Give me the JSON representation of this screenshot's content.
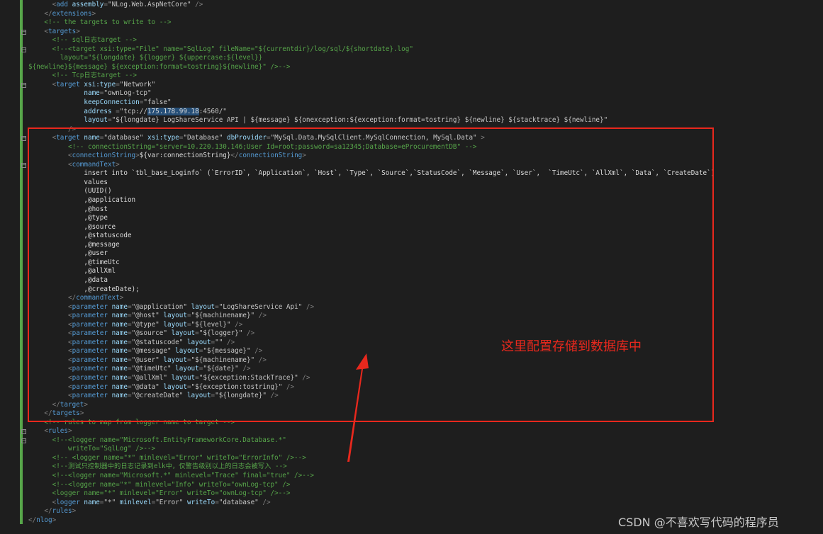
{
  "colors": {
    "background": "#1e1e1e",
    "tag": "#569cd6",
    "attribute": "#9cdcfe",
    "value": "#c8c8c8",
    "comment": "#57a64a",
    "annotation": "#e8281d"
  },
  "lines": [
    {
      "indent": 6,
      "fold": false,
      "tokens": [
        [
          "d",
          "<"
        ],
        [
          "g",
          "add"
        ],
        [
          "t",
          " "
        ],
        [
          "a",
          "assembly"
        ],
        [
          "d",
          "="
        ],
        [
          "v",
          "\"NLog.Web.AspNetCore\""
        ],
        [
          "d",
          " />"
        ]
      ]
    },
    {
      "indent": 4,
      "fold": false,
      "tokens": [
        [
          "d",
          "</"
        ],
        [
          "g",
          "extensions"
        ],
        [
          "d",
          ">"
        ]
      ]
    },
    {
      "indent": 4,
      "fold": false,
      "tokens": [
        [
          "c",
          "<!-- the targets to write to -->"
        ]
      ]
    },
    {
      "indent": 4,
      "fold": true,
      "tokens": [
        [
          "d",
          "<"
        ],
        [
          "g",
          "targets"
        ],
        [
          "d",
          ">"
        ]
      ]
    },
    {
      "indent": 6,
      "fold": false,
      "tokens": [
        [
          "c",
          "<!-- sql日志target -->"
        ]
      ]
    },
    {
      "indent": 6,
      "fold": true,
      "tokens": [
        [
          "c",
          "<!--<target xsi:type=\"File\" name=\"SqlLog\" fileName=\"${currentdir}/log/sql/${shortdate}.log\""
        ]
      ]
    },
    {
      "indent": 8,
      "fold": false,
      "tokens": [
        [
          "c",
          "layout=\"${longdate} ${logger} ${uppercase:${level}}"
        ]
      ]
    },
    {
      "indent": 0,
      "fold": false,
      "tokens": [
        [
          "c",
          "${newline}${message} ${exception:format=tostring}${newline}\" />-->"
        ]
      ]
    },
    {
      "indent": 6,
      "fold": false,
      "tokens": [
        [
          "c",
          "<!-- Tcp日志target -->"
        ]
      ]
    },
    {
      "indent": 6,
      "fold": true,
      "tokens": [
        [
          "d",
          "<"
        ],
        [
          "g",
          "target"
        ],
        [
          "t",
          " "
        ],
        [
          "a",
          "xsi:type"
        ],
        [
          "d",
          "="
        ],
        [
          "v",
          "\"Network\""
        ]
      ]
    },
    {
      "indent": 14,
      "fold": false,
      "tokens": [
        [
          "a",
          "name"
        ],
        [
          "d",
          "="
        ],
        [
          "v",
          "\"ownLog-tcp\""
        ]
      ]
    },
    {
      "indent": 14,
      "fold": false,
      "tokens": [
        [
          "a",
          "keepConnection"
        ],
        [
          "d",
          "="
        ],
        [
          "v",
          "\"false\""
        ]
      ]
    },
    {
      "indent": 14,
      "fold": false,
      "tokens": [
        [
          "a",
          "address "
        ],
        [
          "d",
          "="
        ],
        [
          "v",
          "\"tcp://"
        ],
        [
          "s",
          "175.178.99.18"
        ],
        [
          "v",
          ":4560/\""
        ]
      ]
    },
    {
      "indent": 14,
      "fold": false,
      "tokens": [
        [
          "a",
          "layout"
        ],
        [
          "d",
          "="
        ],
        [
          "v",
          "\"${longdate} LogShareService API | ${message} ${onexception:${exception:format=tostring} ${newline} ${stacktrace} ${newline}\""
        ]
      ]
    },
    {
      "indent": 10,
      "fold": false,
      "tokens": [
        [
          "d",
          "/>"
        ]
      ]
    },
    {
      "indent": 6,
      "fold": true,
      "tokens": [
        [
          "d",
          "<"
        ],
        [
          "g",
          "target"
        ],
        [
          "t",
          " "
        ],
        [
          "a",
          "name"
        ],
        [
          "d",
          "="
        ],
        [
          "v",
          "\"database\""
        ],
        [
          "t",
          " "
        ],
        [
          "a",
          "xsi:type"
        ],
        [
          "d",
          "="
        ],
        [
          "v",
          "\"Database\""
        ],
        [
          "t",
          " "
        ],
        [
          "a",
          "dbProvider"
        ],
        [
          "d",
          "="
        ],
        [
          "v",
          "\"MySql.Data.MySqlClient.MySqlConnection, MySql.Data\""
        ],
        [
          "d",
          " >"
        ]
      ]
    },
    {
      "indent": 10,
      "fold": false,
      "tokens": [
        [
          "c",
          "<!-- connectionString=\"server=10.220.130.146;User Id=root;password=sa12345;Database=eProcurementDB\" -->"
        ]
      ]
    },
    {
      "indent": 10,
      "fold": false,
      "tokens": [
        [
          "d",
          "<"
        ],
        [
          "g",
          "connectionString"
        ],
        [
          "d",
          ">"
        ],
        [
          "t",
          "${var:connectionString}"
        ],
        [
          "d",
          "</"
        ],
        [
          "g",
          "connectionString"
        ],
        [
          "d",
          ">"
        ]
      ]
    },
    {
      "indent": 10,
      "fold": true,
      "tokens": [
        [
          "d",
          "<"
        ],
        [
          "g",
          "commandText"
        ],
        [
          "d",
          ">"
        ]
      ]
    },
    {
      "indent": 14,
      "fold": false,
      "tokens": [
        [
          "t",
          "insert into `tbl_base_Loginfo` (`ErrorID`, `Application`, `Host`, `Type`, `Source`,`StatusCode`, `Message`, `User`,  `TimeUtc`, `AllXml`, `Data`, `CreateDate`)"
        ]
      ]
    },
    {
      "indent": 14,
      "fold": false,
      "tokens": [
        [
          "t",
          "values"
        ]
      ]
    },
    {
      "indent": 14,
      "fold": false,
      "tokens": [
        [
          "t",
          "(UUID()"
        ]
      ]
    },
    {
      "indent": 14,
      "fold": false,
      "tokens": [
        [
          "t",
          ",@application"
        ]
      ]
    },
    {
      "indent": 14,
      "fold": false,
      "tokens": [
        [
          "t",
          ",@host"
        ]
      ]
    },
    {
      "indent": 14,
      "fold": false,
      "tokens": [
        [
          "t",
          ",@type"
        ]
      ]
    },
    {
      "indent": 14,
      "fold": false,
      "tokens": [
        [
          "t",
          ",@source"
        ]
      ]
    },
    {
      "indent": 14,
      "fold": false,
      "tokens": [
        [
          "t",
          ",@statuscode"
        ]
      ]
    },
    {
      "indent": 14,
      "fold": false,
      "tokens": [
        [
          "t",
          ",@message"
        ]
      ]
    },
    {
      "indent": 14,
      "fold": false,
      "tokens": [
        [
          "t",
          ",@user"
        ]
      ]
    },
    {
      "indent": 14,
      "fold": false,
      "tokens": [
        [
          "t",
          ",@timeUtc"
        ]
      ]
    },
    {
      "indent": 14,
      "fold": false,
      "tokens": [
        [
          "t",
          ",@allXml"
        ]
      ]
    },
    {
      "indent": 14,
      "fold": false,
      "tokens": [
        [
          "t",
          ",@data"
        ]
      ]
    },
    {
      "indent": 14,
      "fold": false,
      "tokens": [
        [
          "t",
          ",@createDate);"
        ]
      ]
    },
    {
      "indent": 10,
      "fold": false,
      "tokens": [
        [
          "d",
          "</"
        ],
        [
          "g",
          "commandText"
        ],
        [
          "d",
          ">"
        ]
      ]
    },
    {
      "indent": 10,
      "fold": false,
      "tokens": [
        [
          "d",
          "<"
        ],
        [
          "g",
          "parameter"
        ],
        [
          "t",
          " "
        ],
        [
          "a",
          "name"
        ],
        [
          "d",
          "="
        ],
        [
          "v",
          "\"@application\""
        ],
        [
          "t",
          " "
        ],
        [
          "a",
          "layout"
        ],
        [
          "d",
          "="
        ],
        [
          "v",
          "\"LogShareService Api\""
        ],
        [
          "d",
          " />"
        ]
      ]
    },
    {
      "indent": 10,
      "fold": false,
      "tokens": [
        [
          "d",
          "<"
        ],
        [
          "g",
          "parameter"
        ],
        [
          "t",
          " "
        ],
        [
          "a",
          "name"
        ],
        [
          "d",
          "="
        ],
        [
          "v",
          "\"@host\""
        ],
        [
          "t",
          " "
        ],
        [
          "a",
          "layout"
        ],
        [
          "d",
          "="
        ],
        [
          "v",
          "\"${machinename}\""
        ],
        [
          "d",
          " />"
        ]
      ]
    },
    {
      "indent": 10,
      "fold": false,
      "tokens": [
        [
          "d",
          "<"
        ],
        [
          "g",
          "parameter"
        ],
        [
          "t",
          " "
        ],
        [
          "a",
          "name"
        ],
        [
          "d",
          "="
        ],
        [
          "v",
          "\"@type\""
        ],
        [
          "t",
          " "
        ],
        [
          "a",
          "layout"
        ],
        [
          "d",
          "="
        ],
        [
          "v",
          "\"${level}\""
        ],
        [
          "d",
          " />"
        ]
      ]
    },
    {
      "indent": 10,
      "fold": false,
      "tokens": [
        [
          "d",
          "<"
        ],
        [
          "g",
          "parameter"
        ],
        [
          "t",
          " "
        ],
        [
          "a",
          "name"
        ],
        [
          "d",
          "="
        ],
        [
          "v",
          "\"@source\""
        ],
        [
          "t",
          " "
        ],
        [
          "a",
          "layout"
        ],
        [
          "d",
          "="
        ],
        [
          "v",
          "\"${logger}\""
        ],
        [
          "d",
          " />"
        ]
      ]
    },
    {
      "indent": 10,
      "fold": false,
      "tokens": [
        [
          "d",
          "<"
        ],
        [
          "g",
          "parameter"
        ],
        [
          "t",
          " "
        ],
        [
          "a",
          "name"
        ],
        [
          "d",
          "="
        ],
        [
          "v",
          "\"@statuscode\""
        ],
        [
          "t",
          " "
        ],
        [
          "a",
          "layout"
        ],
        [
          "d",
          "="
        ],
        [
          "v",
          "\"\""
        ],
        [
          "d",
          " />"
        ]
      ]
    },
    {
      "indent": 10,
      "fold": false,
      "tokens": [
        [
          "d",
          "<"
        ],
        [
          "g",
          "parameter"
        ],
        [
          "t",
          " "
        ],
        [
          "a",
          "name"
        ],
        [
          "d",
          "="
        ],
        [
          "v",
          "\"@message\""
        ],
        [
          "t",
          " "
        ],
        [
          "a",
          "layout"
        ],
        [
          "d",
          "="
        ],
        [
          "v",
          "\"${message}\""
        ],
        [
          "d",
          " />"
        ]
      ]
    },
    {
      "indent": 10,
      "fold": false,
      "tokens": [
        [
          "d",
          "<"
        ],
        [
          "g",
          "parameter"
        ],
        [
          "t",
          " "
        ],
        [
          "a",
          "name"
        ],
        [
          "d",
          "="
        ],
        [
          "v",
          "\"@user\""
        ],
        [
          "t",
          " "
        ],
        [
          "a",
          "layout"
        ],
        [
          "d",
          "="
        ],
        [
          "v",
          "\"${machinename}\""
        ],
        [
          "d",
          " />"
        ]
      ]
    },
    {
      "indent": 10,
      "fold": false,
      "tokens": [
        [
          "d",
          "<"
        ],
        [
          "g",
          "parameter"
        ],
        [
          "t",
          " "
        ],
        [
          "a",
          "name"
        ],
        [
          "d",
          "="
        ],
        [
          "v",
          "\"@timeUtc\""
        ],
        [
          "t",
          " "
        ],
        [
          "a",
          "layout"
        ],
        [
          "d",
          "="
        ],
        [
          "v",
          "\"${date}\""
        ],
        [
          "d",
          " />"
        ]
      ]
    },
    {
      "indent": 10,
      "fold": false,
      "tokens": [
        [
          "d",
          "<"
        ],
        [
          "g",
          "parameter"
        ],
        [
          "t",
          " "
        ],
        [
          "a",
          "name"
        ],
        [
          "d",
          "="
        ],
        [
          "v",
          "\"@allXml\""
        ],
        [
          "t",
          " "
        ],
        [
          "a",
          "layout"
        ],
        [
          "d",
          "="
        ],
        [
          "v",
          "\"${exception:StackTrace}\""
        ],
        [
          "d",
          " />"
        ]
      ]
    },
    {
      "indent": 10,
      "fold": false,
      "tokens": [
        [
          "d",
          "<"
        ],
        [
          "g",
          "parameter"
        ],
        [
          "t",
          " "
        ],
        [
          "a",
          "name"
        ],
        [
          "d",
          "="
        ],
        [
          "v",
          "\"@data\""
        ],
        [
          "t",
          " "
        ],
        [
          "a",
          "layout"
        ],
        [
          "d",
          "="
        ],
        [
          "v",
          "\"${exception:tostring}\""
        ],
        [
          "d",
          " />"
        ]
      ]
    },
    {
      "indent": 10,
      "fold": false,
      "tokens": [
        [
          "d",
          "<"
        ],
        [
          "g",
          "parameter"
        ],
        [
          "t",
          " "
        ],
        [
          "a",
          "name"
        ],
        [
          "d",
          "="
        ],
        [
          "v",
          "\"@createDate\""
        ],
        [
          "t",
          " "
        ],
        [
          "a",
          "layout"
        ],
        [
          "d",
          "="
        ],
        [
          "v",
          "\"${longdate}\""
        ],
        [
          "d",
          " />"
        ]
      ]
    },
    {
      "indent": 6,
      "fold": false,
      "tokens": [
        [
          "d",
          "</"
        ],
        [
          "g",
          "target"
        ],
        [
          "d",
          ">"
        ]
      ]
    },
    {
      "indent": 4,
      "fold": false,
      "tokens": [
        [
          "d",
          "</"
        ],
        [
          "g",
          "targets"
        ],
        [
          "d",
          ">"
        ]
      ]
    },
    {
      "indent": 4,
      "fold": false,
      "tokens": [
        [
          "c",
          "<!-- rules to map from logger name to target -->"
        ]
      ]
    },
    {
      "indent": 4,
      "fold": true,
      "tokens": [
        [
          "d",
          "<"
        ],
        [
          "g",
          "rules"
        ],
        [
          "d",
          ">"
        ]
      ]
    },
    {
      "indent": 6,
      "fold": true,
      "tokens": [
        [
          "c",
          "<!--<logger name=\"Microsoft.EntityFrameworkCore.Database.*\""
        ]
      ]
    },
    {
      "indent": 10,
      "fold": false,
      "tokens": [
        [
          "c",
          "writeTo=\"SqlLog\" />-->"
        ]
      ]
    },
    {
      "indent": 6,
      "fold": false,
      "tokens": [
        [
          "c",
          "<!-- <logger name=\"*\" minlevel=\"Error\" writeTo=\"ErrorInfo\" />-->"
        ]
      ]
    },
    {
      "indent": 6,
      "fold": false,
      "tokens": [
        [
          "c",
          "<!--测试只控制器中的日志记录到elk中，仅警告级别以上的日志会被写入 -->"
        ]
      ]
    },
    {
      "indent": 6,
      "fold": false,
      "tokens": [
        [
          "c",
          "<!--<logger name=\"Microsoft.*\" minlevel=\"Trace\" final=\"true\" />-->"
        ]
      ]
    },
    {
      "indent": 6,
      "fold": false,
      "tokens": [
        [
          "c",
          "<!--<logger name=\"*\" minlevel=\"Info\" writeTo=\"ownLog-tcp\" />"
        ]
      ]
    },
    {
      "indent": 6,
      "fold": false,
      "tokens": [
        [
          "c",
          "<logger name=\"*\" minlevel=\"Error\" writeTo=\"ownLog-tcp\" />-->"
        ]
      ]
    },
    {
      "indent": 6,
      "fold": false,
      "tokens": [
        [
          "d",
          "<"
        ],
        [
          "g",
          "logger"
        ],
        [
          "t",
          " "
        ],
        [
          "a",
          "name"
        ],
        [
          "d",
          "="
        ],
        [
          "v",
          "\"*\""
        ],
        [
          "t",
          " "
        ],
        [
          "a",
          "minlevel"
        ],
        [
          "d",
          "="
        ],
        [
          "v",
          "\"Error\""
        ],
        [
          "t",
          " "
        ],
        [
          "a",
          "writeTo"
        ],
        [
          "d",
          "="
        ],
        [
          "v",
          "\"database\""
        ],
        [
          "d",
          " />"
        ]
      ]
    },
    {
      "indent": 4,
      "fold": false,
      "tokens": [
        [
          "d",
          "</"
        ],
        [
          "g",
          "rules"
        ],
        [
          "d",
          ">"
        ]
      ]
    },
    {
      "indent": 0,
      "fold": false,
      "tokens": [
        [
          "d",
          "</"
        ],
        [
          "g",
          "nlog"
        ],
        [
          "d",
          ">"
        ]
      ]
    }
  ],
  "annotation": {
    "text": "这里配置存储到数据库中"
  },
  "watermark": {
    "text": "CSDN @不喜欢写代码的程序员"
  }
}
